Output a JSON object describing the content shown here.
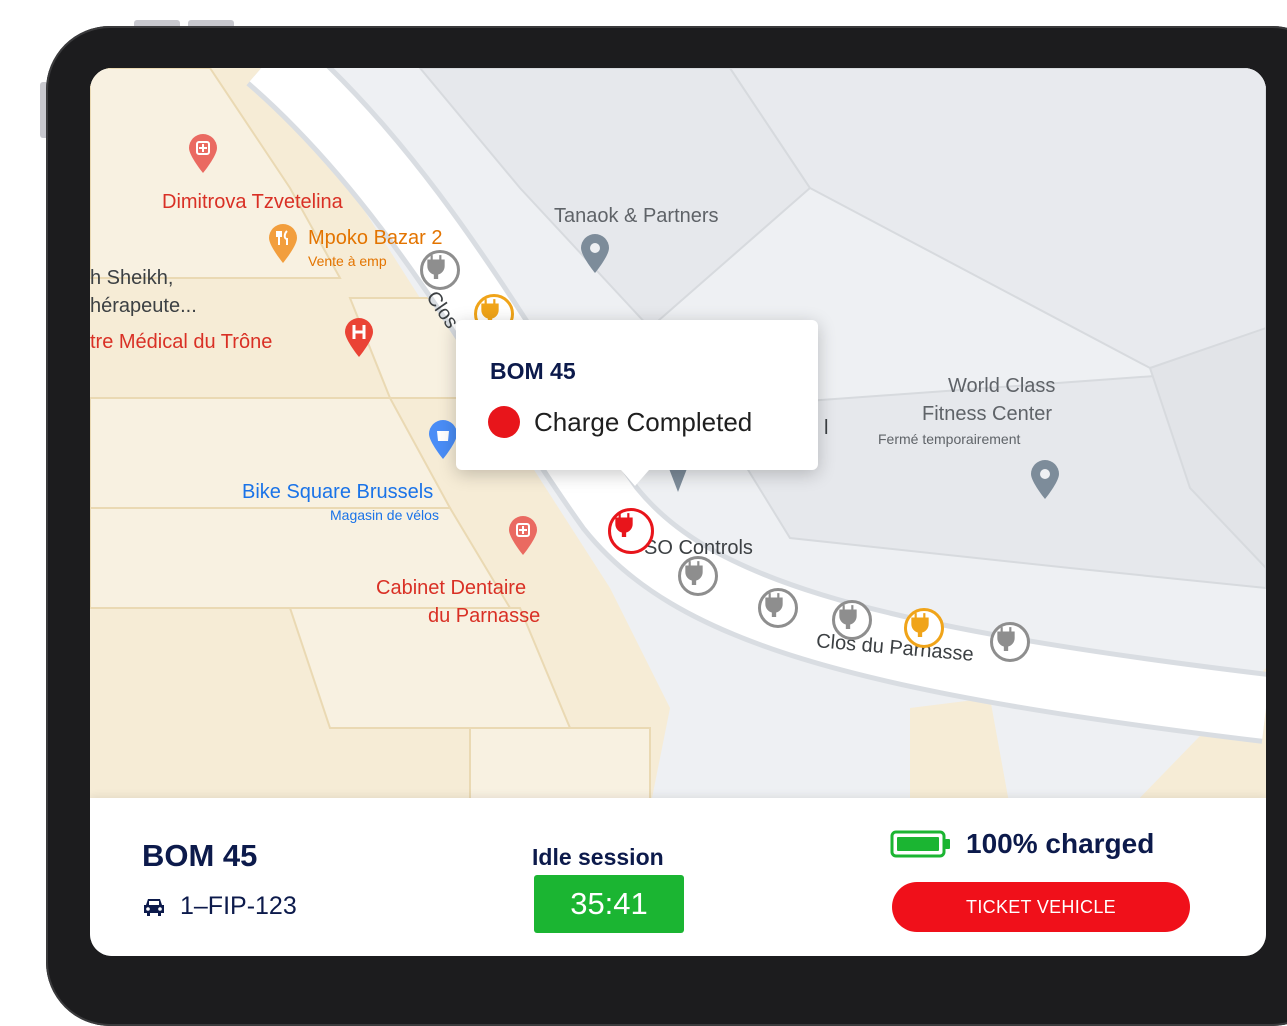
{
  "map": {
    "places": {
      "dimitrova": "Dimitrova Tzvetelina",
      "mpoko": "Mpoko Bazar 2",
      "mpoko_sub": "Vente à emp",
      "sheikh": "h Sheikh,",
      "therapeute": "hérapeute...",
      "centre_medical": "tre Médical du Trône",
      "tanaok": "Tanaok & Partners",
      "world_class": "World Class",
      "fitness_center": "Fitness Center",
      "ferme": "Fermé temporairement",
      "bike_square": "Bike Square Brussels",
      "bike_sub": "Magasin de vélos",
      "cabinet_1": "Cabinet Dentaire",
      "cabinet_2": "du Parnasse",
      "controls": "SO Controls",
      "clos_parnasse": "Clos du Parnasse",
      "clos_short": "Clos",
      "partial_l": "l"
    },
    "popup": {
      "title": "BOM 45",
      "status": "Charge Completed",
      "status_color": "#e8151b"
    },
    "chargers": [
      {
        "icon": "ev-plug-icon",
        "status": "available",
        "color": "#8e8e8e"
      },
      {
        "icon": "ev-plug-icon",
        "status": "charging",
        "color": "#f0a419"
      },
      {
        "icon": "ev-plug-icon",
        "status": "selected",
        "color": "#e8151b"
      },
      {
        "icon": "ev-plug-icon",
        "status": "available",
        "color": "#8e8e8e"
      },
      {
        "icon": "ev-plug-icon",
        "status": "available",
        "color": "#8e8e8e"
      },
      {
        "icon": "ev-plug-icon",
        "status": "available",
        "color": "#8e8e8e"
      },
      {
        "icon": "ev-plug-icon",
        "status": "charging",
        "color": "#f0a419"
      },
      {
        "icon": "ev-plug-icon",
        "status": "available",
        "color": "#8e8e8e"
      }
    ]
  },
  "panel": {
    "title": "BOM 45",
    "plate": "1–FIP-123",
    "plate_icon": "car-icon",
    "idle_label": "Idle session",
    "idle_timer": "35:41",
    "charge_status": "100% charged",
    "battery_icon": "battery-full-icon",
    "ticket_button": "TICKET VEHICLE"
  },
  "colors": {
    "navy": "#0c1a4b",
    "green": "#1bb532",
    "red": "#f0101a",
    "orange": "#f0a419",
    "grey": "#8e8e8e"
  }
}
